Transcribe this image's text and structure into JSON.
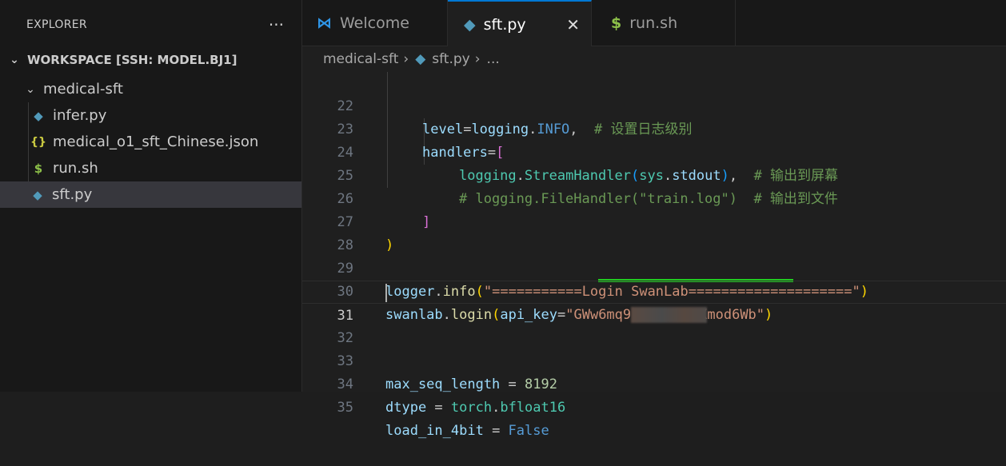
{
  "sidebar": {
    "title": "EXPLORER",
    "more": "···",
    "workspace": "WORKSPACE [SSH: MODEL.BJ1]",
    "folder": "medical-sft",
    "files": [
      {
        "name": "infer.py",
        "icon": "python-icon"
      },
      {
        "name": "medical_o1_sft_Chinese.json",
        "icon": "json-icon"
      },
      {
        "name": "run.sh",
        "icon": "shell-icon"
      },
      {
        "name": "sft.py",
        "icon": "python-icon"
      }
    ],
    "selected": "sft.py"
  },
  "tabs": [
    {
      "label": "Welcome",
      "icon": "vscode-icon"
    },
    {
      "label": "sft.py",
      "icon": "python-icon",
      "active": true
    },
    {
      "label": "run.sh",
      "icon": "shell-icon"
    }
  ],
  "breadcrumb": {
    "folder": "medical-sft",
    "file": "sft.py",
    "more": "..."
  },
  "editor": {
    "line_numbers": [
      "22",
      "23",
      "24",
      "25",
      "26",
      "27",
      "28",
      "29",
      "30",
      "31",
      "32",
      "33",
      "34",
      "35"
    ],
    "current_line": "31",
    "code": {
      "l22": {
        "a": "level",
        "b": "=",
        "c": "logging",
        "d": ".",
        "e": "INFO",
        "f": ",  ",
        "g": "# 设置日志级别"
      },
      "l23": {
        "a": "handlers",
        "b": "=",
        "c": "["
      },
      "l24": {
        "a": "logging",
        "b": ".",
        "c": "StreamHandler",
        "d": "(",
        "e": "sys",
        "f": ".",
        "g": "stdout",
        "h": ")",
        "i": ",  ",
        "j": "# 输出到屏幕"
      },
      "l25": {
        "a": "# logging.FileHandler(\"train.log\")  # 输出到文件"
      },
      "l26": {
        "a": "]"
      },
      "l27": {
        "a": ")"
      },
      "l29": {
        "a": "logger",
        "b": ".",
        "c": "info",
        "d": "(",
        "e": "\"===========Login SwanLab====================\"",
        "f": ")"
      },
      "l30": {
        "a": "swanlab",
        "b": ".",
        "c": "login",
        "d": "(",
        "e": "api_key",
        "f": "=",
        "g": "\"GWw6mq9",
        "h": "Xmod6Wb\"",
        "i": ")"
      },
      "l33": {
        "a": "max_seq_length",
        "b": " = ",
        "c": "8192"
      },
      "l34": {
        "a": "dtype",
        "b": " = ",
        "c": "torch",
        "d": ".",
        "e": "bfloat16"
      },
      "l35": {
        "a": "load_in_4bit",
        "b": " = ",
        "c": "False"
      }
    }
  },
  "colors": {
    "accent": "#0078d4",
    "highlight_underline": "#22cc22"
  }
}
